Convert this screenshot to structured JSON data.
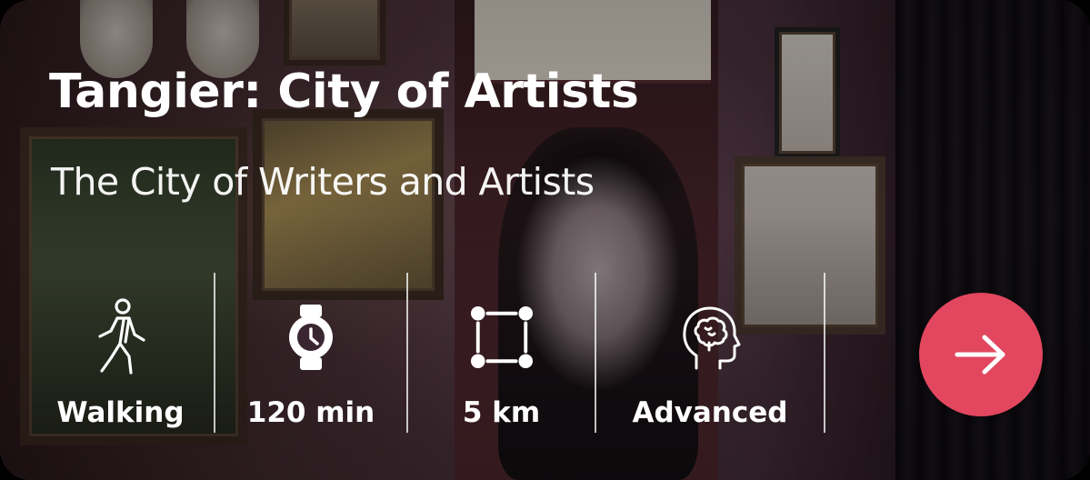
{
  "tour": {
    "title": "Tangier: City of Artists",
    "subtitle": "The City of Writers and Artists"
  },
  "stats": [
    {
      "icon": "walking-person-icon",
      "label": "Walking"
    },
    {
      "icon": "watch-icon",
      "label": "120 min"
    },
    {
      "icon": "distance-square-icon",
      "label": "5 km"
    },
    {
      "icon": "brain-head-icon",
      "label": "Advanced"
    }
  ],
  "action": {
    "icon": "arrow-right-icon"
  },
  "colors": {
    "accent": "#e2475f",
    "text": "#ffffff"
  }
}
